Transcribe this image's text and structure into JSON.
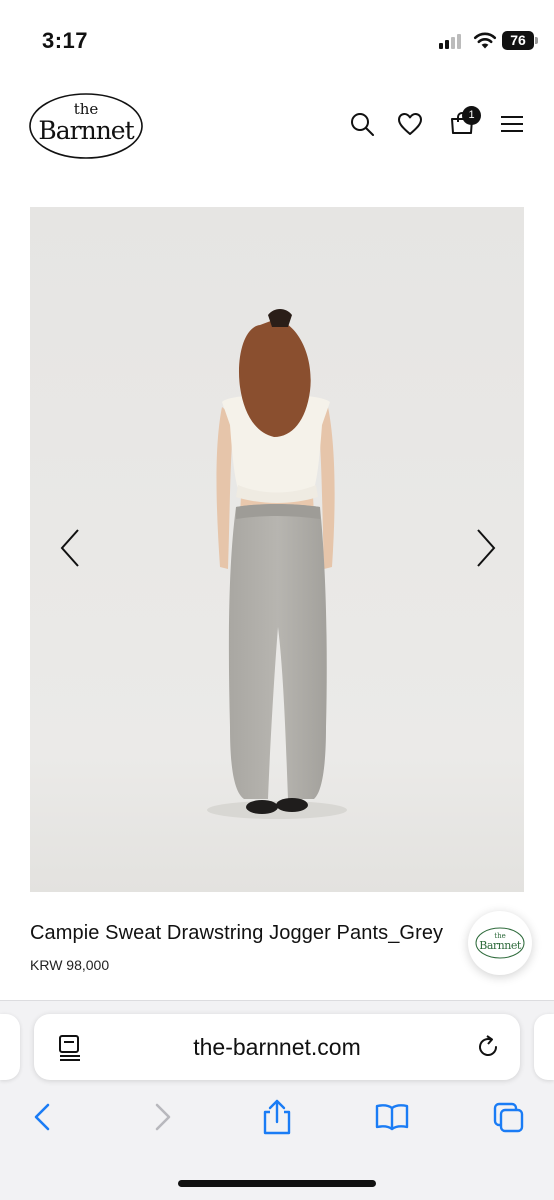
{
  "status": {
    "time": "3:17",
    "battery": "76"
  },
  "brand": {
    "logo_small": "the",
    "logo_main": "Barnnet"
  },
  "header": {
    "cart_count": "1"
  },
  "product": {
    "title": "Campie Sweat Drawstring Jogger Pants_Grey",
    "price": "KRW 98,000"
  },
  "browser": {
    "url": "the-barnnet.com"
  },
  "icons": {
    "search": "search-icon",
    "wishlist": "heart-icon",
    "cart": "shopping-bag-icon",
    "menu": "hamburger-menu-icon",
    "prev": "chevron-left-icon",
    "next": "chevron-right-icon",
    "page_settings": "page-menu-icon",
    "reload": "reload-icon",
    "back": "back-icon",
    "forward": "forward-icon",
    "share": "share-icon",
    "bookmarks": "book-icon",
    "tabs": "tabs-icon"
  },
  "colors": {
    "accent_dark": "#111111",
    "safari_blue": "#1a7cf5",
    "image_bg": "#e9e8e6",
    "logo_green": "#2f6b3c"
  }
}
